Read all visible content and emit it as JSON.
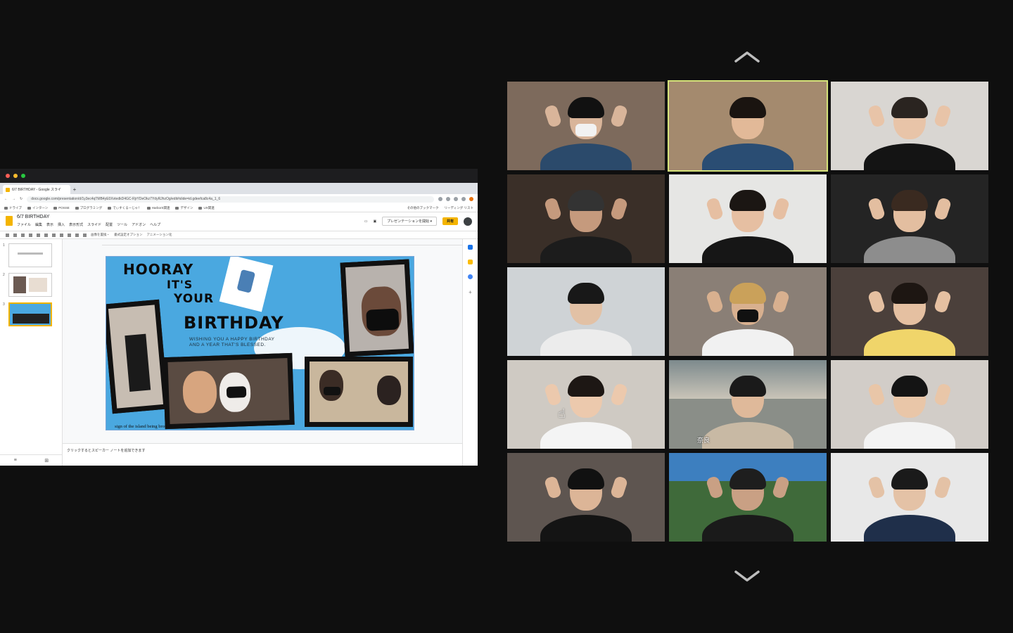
{
  "browser": {
    "tab_title": "6/7 BIRTHDAY - Google スライ",
    "new_tab": "+",
    "url": "docs.google.com/presentation/d/1y3ec4qTMB4yE0XvtedkD4GC-RjrYDeOkz7YdyRJhzOg/edit#slide=id.gdeefca8c4a_1_6",
    "bookmarks": [
      "ドライブ",
      "インターン",
      "POSSE",
      "プログラミング",
      "でぃすくるーじゃ！",
      "HarborS関連",
      "デザイン",
      "UX関連"
    ],
    "bookmarks_right": [
      "その他のブックマーク",
      "リーディング リスト"
    ]
  },
  "slides": {
    "doc_title": "6/7 BIRTHDAY",
    "menus": [
      "ファイル",
      "編集",
      "表示",
      "挿入",
      "表示形式",
      "スライド",
      "配置",
      "ツール",
      "アドオン",
      "ヘルプ"
    ],
    "present_label": "プレゼンテーションを開始",
    "share_label": "共有",
    "toolbar_items": [
      "画像を置換・",
      "書式設定オプション",
      "アニメーション化"
    ],
    "slide_numbers": [
      "1",
      "2",
      "3"
    ],
    "notes_placeholder": "クリックするとスピーカー ノートを追加できます"
  },
  "slide_content": {
    "line1": "HOORAY",
    "line2": "IT'S",
    "line3": "YOUR",
    "line4": "BIRTHDAY",
    "subtitle": "WISHING YOU A HAPPY BIRTHDAY\nAND A YEAR THAT'S BLESSED.",
    "caption": "sign of the island being brought back to life"
  },
  "gallery": {
    "nav_up": "︿",
    "nav_down": "﹀",
    "participants": [
      {
        "name": ""
      },
      {
        "name": "",
        "active": true
      },
      {
        "name": ""
      },
      {
        "name": ""
      },
      {
        "name": ""
      },
      {
        "name": ""
      },
      {
        "name": ""
      },
      {
        "name": ""
      },
      {
        "name": ""
      },
      {
        "name": ""
      },
      {
        "name": "奈良"
      },
      {
        "name": ""
      },
      {
        "name": ""
      },
      {
        "name": ""
      },
      {
        "name": ""
      }
    ]
  },
  "colors": {
    "active_speaker_border": "#d5e37a",
    "slides_accent": "#f4b400",
    "slide_background": "#4aa8e0"
  }
}
